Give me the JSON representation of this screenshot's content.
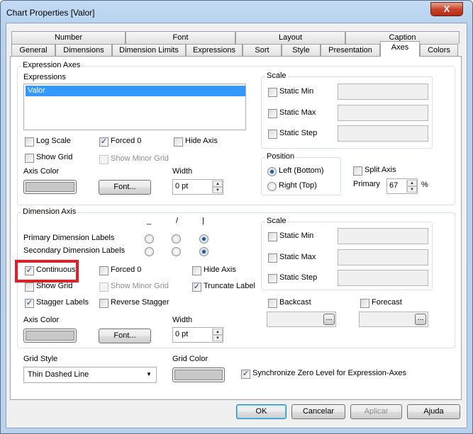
{
  "window": {
    "title": "Chart Properties [Valor]",
    "close": "X"
  },
  "tabs_row1": [
    "Number",
    "Font",
    "Layout",
    "Caption"
  ],
  "tabs_row2": [
    "General",
    "Dimensions",
    "Dimension Limits",
    "Expressions",
    "Sort",
    "Style",
    "Presentation",
    "Axes",
    "Colors"
  ],
  "selected_tab": "Axes",
  "expr_axes": {
    "title": "Expression Axes",
    "expressions_label": "Expressions",
    "expressions": [
      "Valor"
    ],
    "log_scale": "Log Scale",
    "forced0": "Forced 0",
    "hide_axis": "Hide Axis",
    "show_grid": "Show Grid",
    "show_minor_grid": "Show Minor Grid",
    "axis_color": "Axis Color",
    "font_btn": "Font...",
    "width_label": "Width",
    "width_value": "0 pt",
    "scale": {
      "title": "Scale",
      "static_min": "Static Min",
      "static_max": "Static Max",
      "static_step": "Static Step"
    },
    "position": {
      "title": "Position",
      "left": "Left (Bottom)",
      "right": "Right (Top)"
    },
    "split_axis": "Split Axis",
    "primary_label": "Primary",
    "primary_value": "67",
    "percent": "%"
  },
  "dim_axis": {
    "title": "Dimension Axis",
    "orient_headers": [
      "_",
      "/",
      "|"
    ],
    "primary_labels": "Primary Dimension Labels",
    "secondary_labels": "Secondary Dimension Labels",
    "continuous": "Continuous",
    "forced0": "Forced 0",
    "hide_axis": "Hide Axis",
    "show_grid": "Show Grid",
    "show_minor_grid": "Show Minor Grid",
    "truncate_label": "Truncate Label",
    "stagger_labels": "Stagger Labels",
    "reverse_stagger": "Reverse Stagger",
    "axis_color": "Axis Color",
    "font_btn": "Font...",
    "width_label": "Width",
    "width_value": "0 pt",
    "scale": {
      "title": "Scale",
      "static_min": "Static Min",
      "static_max": "Static Max",
      "static_step": "Static Step"
    },
    "backcast": "Backcast",
    "forecast": "Forecast",
    "ellipsis": "..."
  },
  "grid": {
    "style_label": "Grid Style",
    "style_value": "Thin Dashed Line",
    "color_label": "Grid Color",
    "sync_label": "Synchronize Zero Level for Expression-Axes"
  },
  "buttons": {
    "ok": "OK",
    "cancel": "Cancelar",
    "apply": "Aplicar",
    "help": "Ajuda"
  },
  "colors": {
    "highlight": "#e81c24",
    "selection": "#3399ff"
  }
}
